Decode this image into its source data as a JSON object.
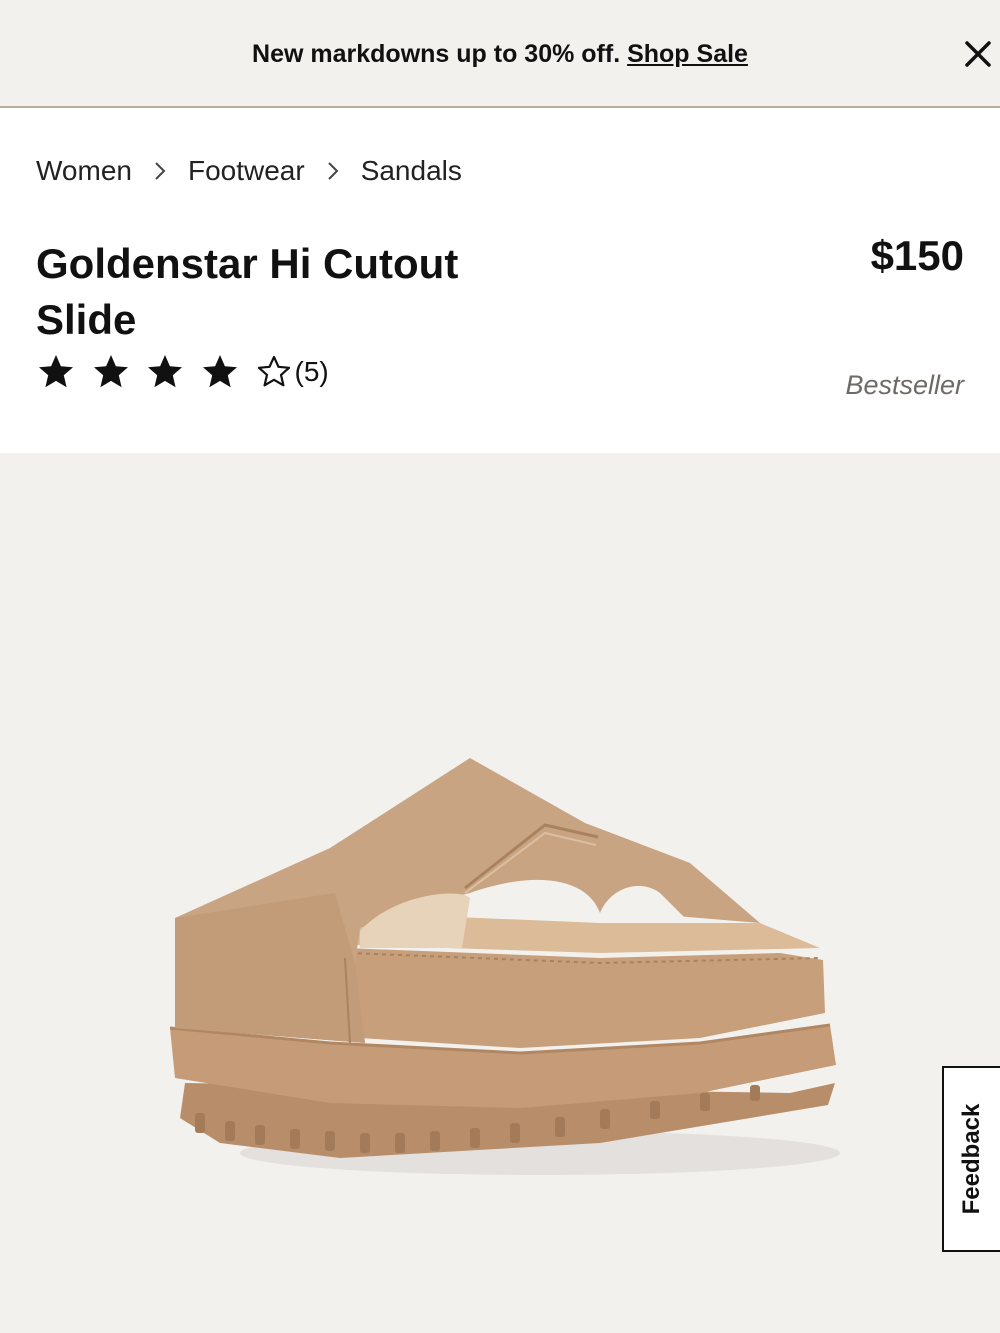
{
  "promo": {
    "message": "New markdowns up to 30% off.",
    "link_label": "Shop Sale",
    "close_icon": "close-icon"
  },
  "breadcrumb": {
    "items": [
      {
        "label": "Women"
      },
      {
        "label": "Footwear"
      },
      {
        "label": "Sandals"
      }
    ],
    "separator_icon": "chevron-right-icon"
  },
  "product": {
    "title_line1": "Goldenstar Hi Cutout",
    "title_line2": "Slide",
    "price": "$150",
    "rating": 4,
    "rating_max": 5,
    "review_count": "(5)",
    "badge": "Bestseller",
    "image_icon": "sandal-product-image"
  },
  "feedback": {
    "label": "Feedback"
  },
  "colors": {
    "promo_bg": "#f3f1ee",
    "hero_bg": "#f2f1ee",
    "badge_text": "#6e6a66",
    "sandal": "#c9a482"
  }
}
